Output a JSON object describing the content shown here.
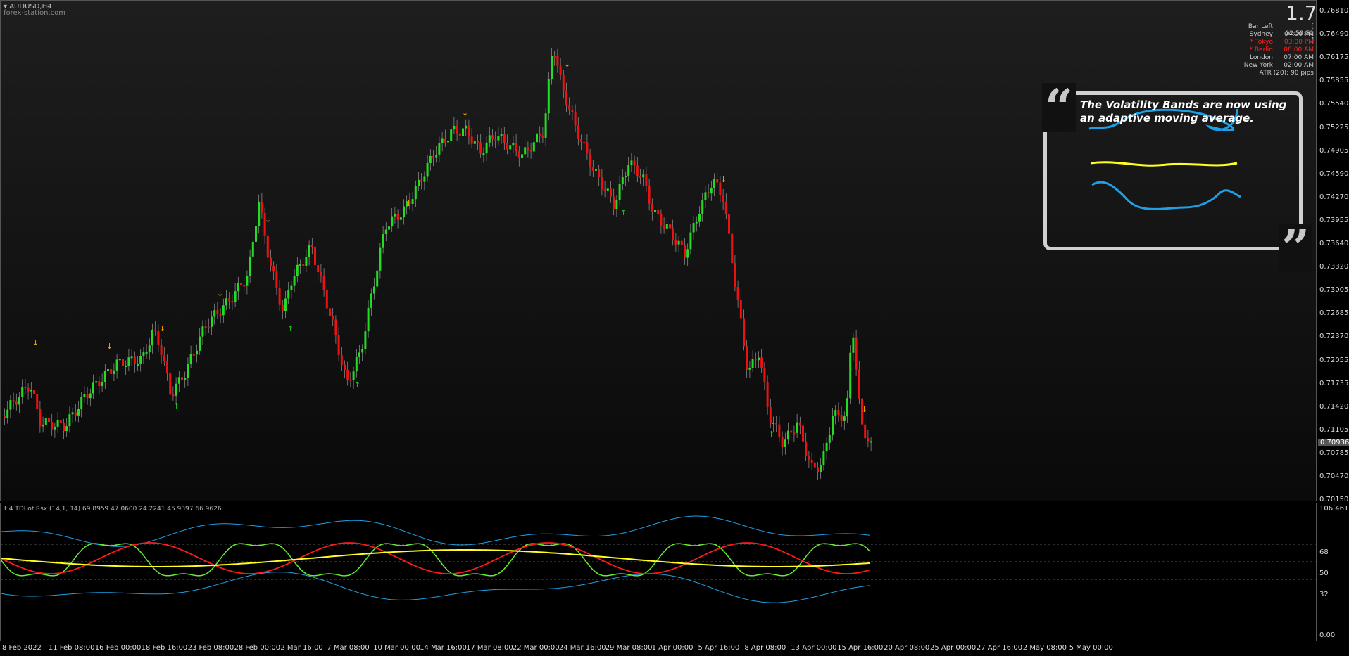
{
  "chart": {
    "symbol_label": "AUDUSD,H4",
    "watermark": "forex-station.com",
    "version": "1.7",
    "current_price": "0.70936"
  },
  "info_panel": {
    "rows": [
      {
        "label": "Bar Left",
        "value": "[ 02:59:51 ]",
        "color": "#cccccc"
      },
      {
        "label": "Sydney",
        "value": "04:00 PM",
        "color": "#cccccc"
      },
      {
        "label": "* Tokyo",
        "value": "03:00 PM",
        "color": "#ff2020"
      },
      {
        "label": "* Berlin",
        "value": "08:00 AM",
        "color": "#ff2020"
      },
      {
        "label": "London",
        "value": "07:00 AM",
        "color": "#cccccc"
      },
      {
        "label": "New York",
        "value": "02:00 AM",
        "color": "#cccccc"
      }
    ],
    "atr": "ATR (20): 90 pips"
  },
  "callout": {
    "text": "The Volatility Bands are now using an adaptive moving average."
  },
  "indicator": {
    "label": "H4 TDI of Rsx (14,1, 14) 69.8959 47.0600 24.2241 45.9397 66.9626",
    "levels": [
      "106.4615",
      "68",
      "50",
      "32",
      "0.00"
    ]
  },
  "price_axis": [
    "0.76810",
    "0.76490",
    "0.76175",
    "0.75855",
    "0.75540",
    "0.75225",
    "0.74905",
    "0.74590",
    "0.74270",
    "0.73955",
    "0.73640",
    "0.73320",
    "0.73005",
    "0.72685",
    "0.72370",
    "0.72055",
    "0.71735",
    "0.71420",
    "0.71105",
    "0.70785",
    "0.70470",
    "0.70150"
  ],
  "time_axis": [
    "8 Feb 2022",
    "11 Feb 08:00",
    "16 Feb 00:00",
    "18 Feb 16:00",
    "23 Feb 08:00",
    "28 Feb 00:00",
    "2 Mar 16:00",
    "7 Mar 08:00",
    "10 Mar 00:00",
    "14 Mar 16:00",
    "17 Mar 08:00",
    "22 Mar 00:00",
    "24 Mar 16:00",
    "29 Mar 08:00",
    "1 Apr 00:00",
    "5 Apr 16:00",
    "8 Apr 08:00",
    "13 Apr 00:00",
    "15 Apr 16:00",
    "20 Apr 08:00",
    "25 Apr 00:00",
    "27 Apr 16:00",
    "2 May 08:00",
    "5 May 00:00"
  ],
  "colors": {
    "bull": "#22dd22",
    "bear": "#ee1111",
    "band": "#1ea0e6",
    "signal_red": "#ff1a1a",
    "signal_green": "#66ee33",
    "signal_yellow": "#ffff22",
    "arrow_down": "#ffaa00",
    "arrow_up": "#22cc22"
  }
}
